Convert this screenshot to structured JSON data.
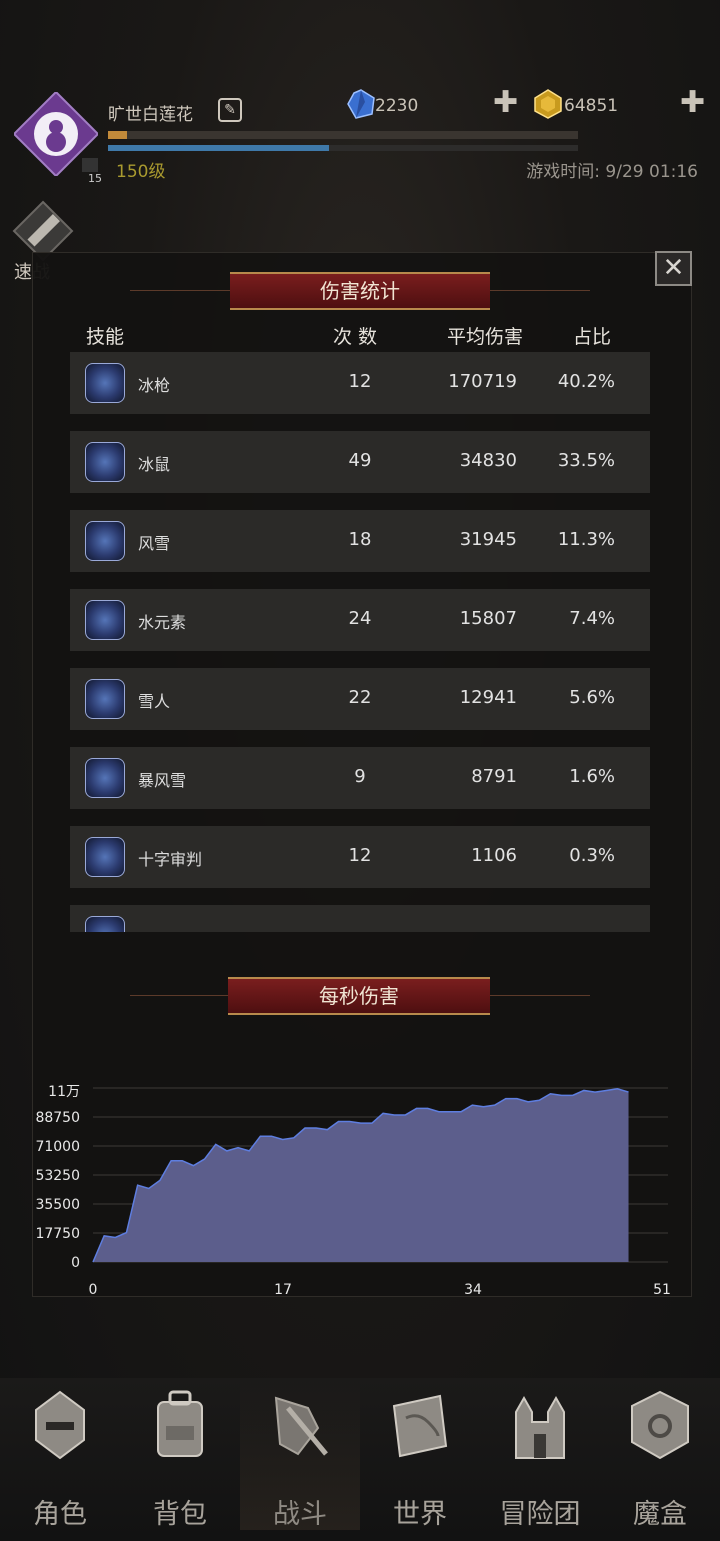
{
  "header": {
    "player_name": "旷世白莲花",
    "level": "150级",
    "avatar_badge": "15",
    "currency_gem": "2230",
    "currency_gold": "64851",
    "game_time": "游戏时间: 9/29 01:16",
    "speed_battle": "速战",
    "xp_progress": 0.04,
    "hp_progress": 0.47
  },
  "damage_panel": {
    "title": "伤害统计",
    "columns": {
      "skill": "技能",
      "count": "次 数",
      "avg_damage": "平均伤害",
      "ratio": "占比"
    },
    "rows": [
      {
        "skill": "冰枪",
        "count": "12",
        "avg": "170719",
        "ratio": "40.2%",
        "icon": "ice-spear-icon"
      },
      {
        "skill": "冰鼠",
        "count": "49",
        "avg": "34830",
        "ratio": "33.5%",
        "icon": "ice-rat-icon"
      },
      {
        "skill": "风雪",
        "count": "18",
        "avg": "31945",
        "ratio": "11.3%",
        "icon": "sword-icon"
      },
      {
        "skill": "水元素",
        "count": "24",
        "avg": "15807",
        "ratio": "7.4%",
        "icon": "water-elemental-icon"
      },
      {
        "skill": "雪人",
        "count": "22",
        "avg": "12941",
        "ratio": "5.6%",
        "icon": "snowflake-icon"
      },
      {
        "skill": "暴风雪",
        "count": "9",
        "avg": "8791",
        "ratio": "1.6%",
        "icon": "blizzard-icon"
      },
      {
        "skill": "十字审判",
        "count": "12",
        "avg": "1106",
        "ratio": "0.3%",
        "icon": "banner-icon"
      }
    ],
    "close_label": "✕"
  },
  "dps_panel": {
    "title": "每秒伤害"
  },
  "chart_data": {
    "type": "area",
    "title": "每秒伤害",
    "xlabel": "",
    "ylabel": "",
    "x_ticks": [
      "0",
      "17",
      "34",
      "51"
    ],
    "y_ticks": [
      "0",
      "17750",
      "35500",
      "53250",
      "71000",
      "88750",
      "11万"
    ],
    "xlim": [
      0,
      51
    ],
    "ylim": [
      0,
      106500
    ],
    "grid": true,
    "color": "#5c5e8c",
    "x": [
      0,
      1,
      2,
      3,
      4,
      5,
      6,
      7,
      8,
      9,
      10,
      11,
      12,
      13,
      14,
      15,
      16,
      17,
      18,
      19,
      20,
      21,
      22,
      23,
      24,
      25,
      26,
      27,
      28,
      29,
      30,
      31,
      32,
      33,
      34,
      35,
      36,
      37,
      38,
      39,
      40,
      41,
      42,
      43,
      44,
      45,
      46,
      47,
      48
    ],
    "y": [
      0,
      16000,
      15000,
      18000,
      47000,
      45000,
      50000,
      62000,
      62000,
      59000,
      63000,
      72000,
      68000,
      70000,
      68000,
      77000,
      77000,
      75000,
      76000,
      82000,
      82000,
      81000,
      86000,
      86000,
      85000,
      85000,
      91000,
      90000,
      90000,
      94000,
      94000,
      92000,
      92000,
      92000,
      96000,
      95000,
      96000,
      100000,
      100000,
      98000,
      99000,
      103000,
      102000,
      102000,
      105000,
      104000,
      105000,
      106000,
      104000
    ]
  },
  "nav": [
    {
      "label": "角色",
      "icon": "helmet-icon"
    },
    {
      "label": "背包",
      "icon": "backpack-icon"
    },
    {
      "label": "战斗",
      "icon": "crossed-swords-icon"
    },
    {
      "label": "世界",
      "icon": "map-scroll-icon"
    },
    {
      "label": "冒险团",
      "icon": "castle-icon"
    },
    {
      "label": "魔盒",
      "icon": "magic-cube-icon"
    }
  ]
}
